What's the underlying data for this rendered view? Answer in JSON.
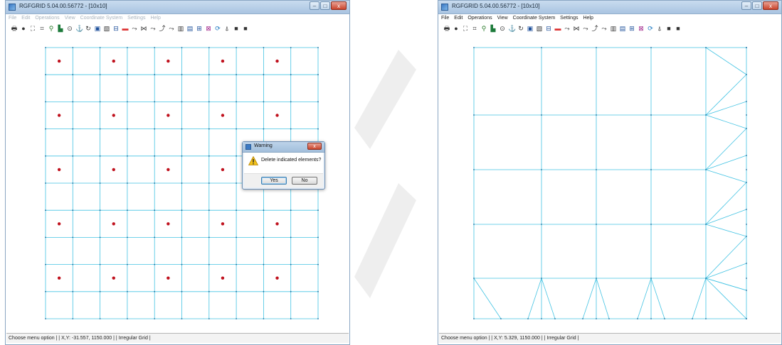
{
  "left_window": {
    "title": "RGFGRID 5.04.00.56772 - [10x10]",
    "menu": [
      "File",
      "Edit",
      "Operations",
      "View",
      "Coordinate System",
      "Settings",
      "Help"
    ],
    "status": "Choose menu option | | X,Y:     -31.557,     1150.000 | | Irregular Grid |"
  },
  "right_window": {
    "title": "RGFGRID 5.04.00.56772 - [10x10]",
    "menu": [
      "File",
      "Edit",
      "Operations",
      "View",
      "Coordinate System",
      "Settings",
      "Help"
    ],
    "status": "Choose menu option | | X,Y:     5.329,     1150.000 | | Irregular Grid |"
  },
  "dialog": {
    "title": "Warning",
    "message": "Delete indicated elements?",
    "yes_label": "Yes",
    "no_label": "No",
    "close_label": "x"
  },
  "window_controls": {
    "minimize": "–",
    "maximize": "□",
    "close": "x"
  },
  "colors": {
    "grid_line": "#43c3e3",
    "grid_node": "#1f6fa0",
    "marked_point": "#c0121e",
    "titlebar": "#b6cde6",
    "watermark": "#eeeeee"
  },
  "toolbar_icons": [
    "print-icon",
    "sphere-icon",
    "zoom-fit-icon",
    "grid-icon",
    "zoom-icon",
    "chart-icon",
    "target-icon",
    "anchor-icon",
    "refresh-icon",
    "select-box-icon",
    "deselect-icon",
    "spline-icon",
    "colorbar-icon",
    "spline-add-icon",
    "spline-delete-icon",
    "spline-move-icon",
    "spline-insert-icon",
    "spline-split-icon",
    "grid-refine-icon",
    "grid-join-icon",
    "grid-add-icon",
    "grid-delete-icon",
    "orthogonalise-icon",
    "smooth-icon",
    "black-square-icon",
    "black-square-2-icon"
  ]
}
